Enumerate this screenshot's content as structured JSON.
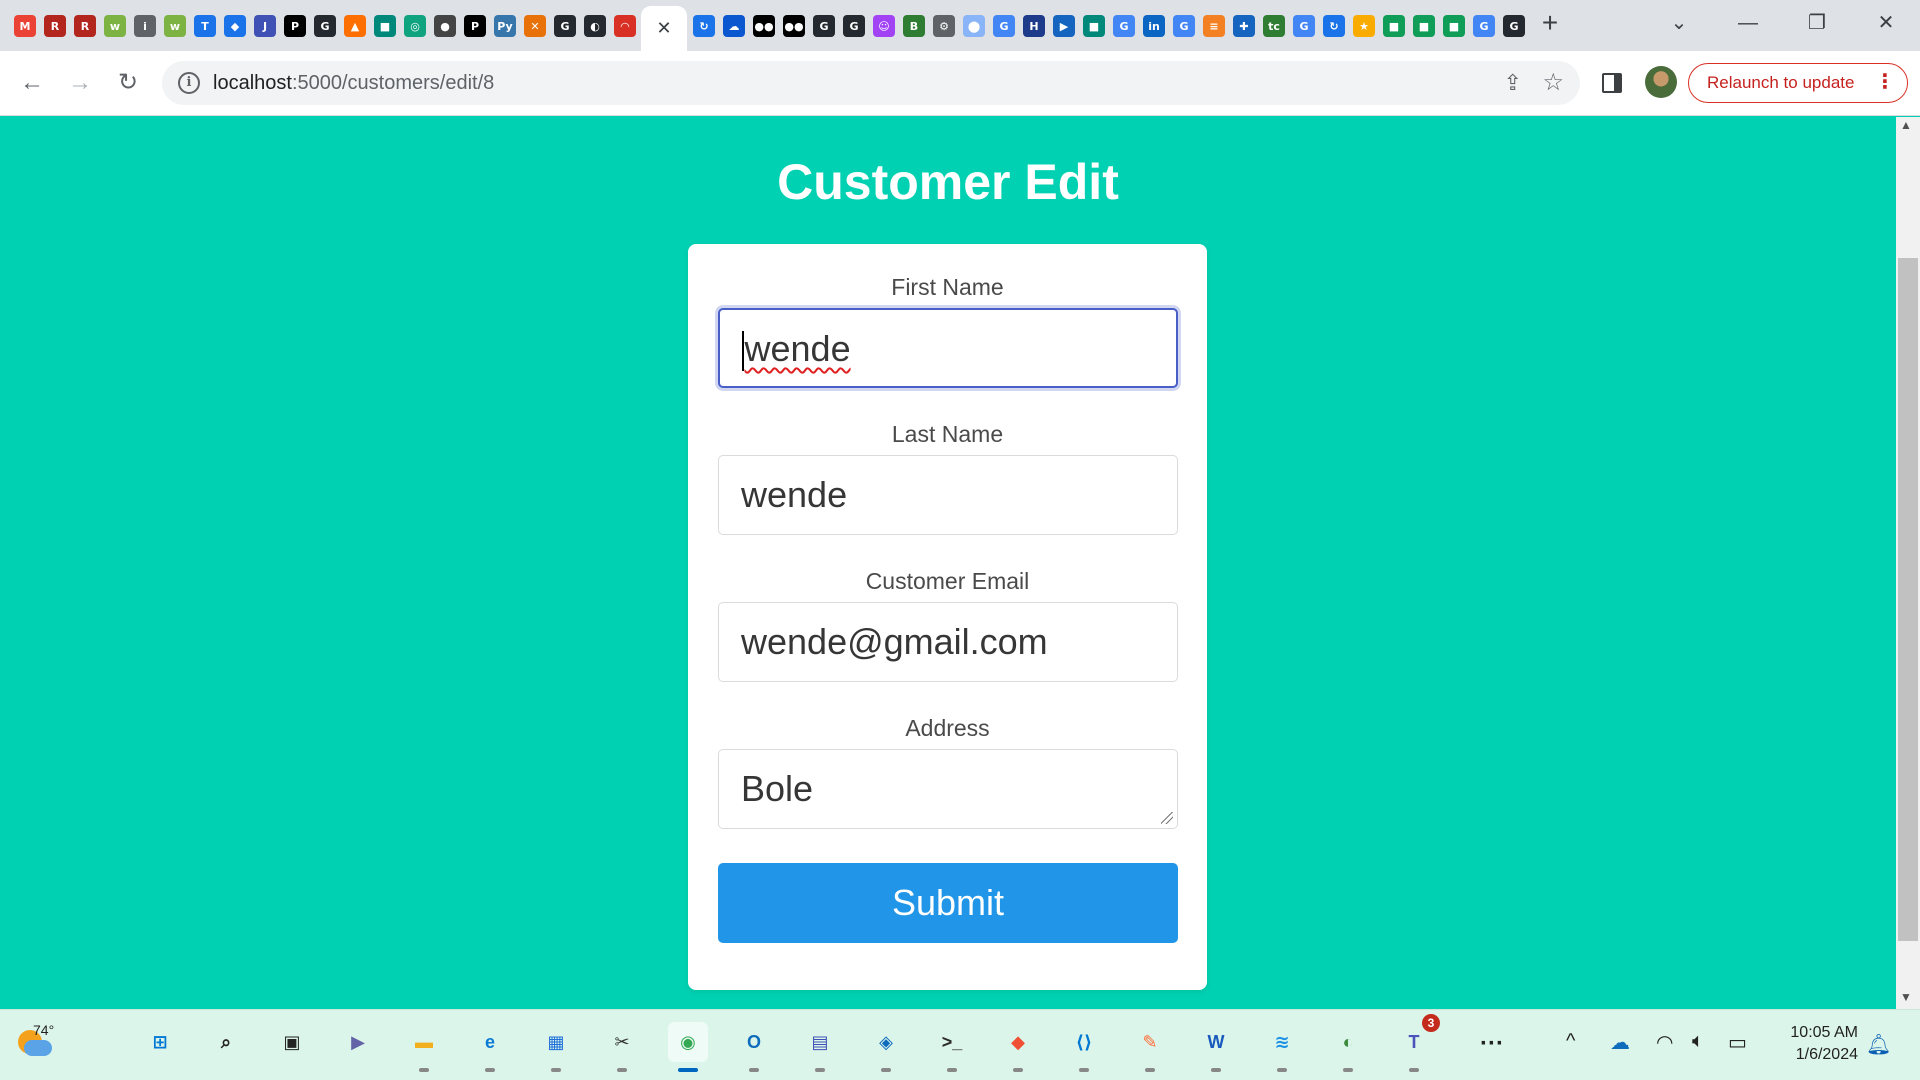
{
  "browser": {
    "tabs_left": [
      {
        "icon": "gmail-icon",
        "glyph": "M",
        "color": "#ea4335"
      },
      {
        "icon": "tab-icon-red-1",
        "glyph": "R",
        "color": "#b3261e"
      },
      {
        "icon": "tab-icon-red-2",
        "glyph": "R",
        "color": "#b3261e"
      },
      {
        "icon": "tab-icon-green-1",
        "glyph": "w",
        "color": "#7cb342"
      },
      {
        "icon": "info-tab-icon",
        "glyph": "i",
        "color": "#5f6368"
      },
      {
        "icon": "tab-icon-green-2",
        "glyph": "w",
        "color": "#7cb342"
      },
      {
        "icon": "tab-icon-t",
        "glyph": "T",
        "color": "#1a73e8"
      },
      {
        "icon": "tab-icon-diamond",
        "glyph": "◆",
        "color": "#1a73e8"
      },
      {
        "icon": "tab-icon-j2c",
        "glyph": "J",
        "color": "#3f51b5"
      },
      {
        "icon": "tab-icon-p",
        "glyph": "P",
        "color": "#000000"
      },
      {
        "icon": "github-icon",
        "glyph": "G",
        "color": "#24292f"
      },
      {
        "icon": "tab-icon-orange",
        "glyph": "▲",
        "color": "#ff6f00"
      },
      {
        "icon": "meet-icon",
        "glyph": "■",
        "color": "#00897b"
      },
      {
        "icon": "chatgpt-icon",
        "glyph": "◎",
        "color": "#10a37f"
      },
      {
        "icon": "tab-icon-globe",
        "glyph": "●",
        "color": "#444444"
      },
      {
        "icon": "tab-icon-p2",
        "glyph": "P",
        "color": "#000000"
      },
      {
        "icon": "python-icon",
        "glyph": "Py",
        "color": "#3776ab"
      },
      {
        "icon": "tab-icon-x",
        "glyph": "✕",
        "color": "#e8710a"
      },
      {
        "icon": "github-icon-2",
        "glyph": "G",
        "color": "#24292f"
      },
      {
        "icon": "tab-icon-circle",
        "glyph": "◐",
        "color": "#24292f"
      },
      {
        "icon": "tab-icon-arc",
        "glyph": "◠",
        "color": "#d93025"
      }
    ],
    "active_tab_close": "✕",
    "tabs_right": [
      {
        "icon": "tab-icon-loop",
        "glyph": "↻",
        "color": "#1a73e8"
      },
      {
        "icon": "tab-icon-cloud",
        "glyph": "☁",
        "color": "#0b57d0"
      },
      {
        "icon": "medium-icon-1",
        "glyph": "●●",
        "color": "#000000"
      },
      {
        "icon": "medium-icon-2",
        "glyph": "●●",
        "color": "#000000"
      },
      {
        "icon": "github-icon-3",
        "glyph": "G",
        "color": "#24292f"
      },
      {
        "icon": "github-icon-4",
        "glyph": "G",
        "color": "#24292f"
      },
      {
        "icon": "tab-icon-bot",
        "glyph": "☺",
        "color": "#a142f4"
      },
      {
        "icon": "tab-icon-b64",
        "glyph": "B",
        "color": "#2e7d32"
      },
      {
        "icon": "tab-icon-gear",
        "glyph": "⚙",
        "color": "#5f6368"
      },
      {
        "icon": "tab-icon-pin",
        "glyph": "⬤",
        "color": "#8ab4f8"
      },
      {
        "icon": "google-icon-1",
        "glyph": "G",
        "color": "#4285f4"
      },
      {
        "icon": "tab-icon-hst",
        "glyph": "H",
        "color": "#1e3a8a"
      },
      {
        "icon": "tab-icon-video",
        "glyph": "▶",
        "color": "#1565c0"
      },
      {
        "icon": "meet-icon-2",
        "glyph": "■",
        "color": "#00897b"
      },
      {
        "icon": "google-icon-2",
        "glyph": "G",
        "color": "#4285f4"
      },
      {
        "icon": "linkedin-icon",
        "glyph": "in",
        "color": "#0a66c2"
      },
      {
        "icon": "google-icon-3",
        "glyph": "G",
        "color": "#4285f4"
      },
      {
        "icon": "stackoverflow-icon",
        "glyph": "≡",
        "color": "#f48024"
      },
      {
        "icon": "tab-icon-puzzle",
        "glyph": "✚",
        "color": "#1565c0"
      },
      {
        "icon": "tab-icon-tc",
        "glyph": "tc",
        "color": "#2e7d32"
      },
      {
        "icon": "google-icon-4",
        "glyph": "G",
        "color": "#4285f4"
      },
      {
        "icon": "tab-icon-loop-2",
        "glyph": "↻",
        "color": "#1a73e8"
      },
      {
        "icon": "tab-icon-star",
        "glyph": "★",
        "color": "#f9ab00"
      },
      {
        "icon": "sheets-icon-1",
        "glyph": "■",
        "color": "#0f9d58"
      },
      {
        "icon": "sheets-icon-2",
        "glyph": "■",
        "color": "#0f9d58"
      },
      {
        "icon": "sheets-icon-3",
        "glyph": "■",
        "color": "#0f9d58"
      },
      {
        "icon": "google-icon-5",
        "glyph": "G",
        "color": "#4285f4"
      },
      {
        "icon": "github-icon-5",
        "glyph": "G",
        "color": "#24292f"
      }
    ],
    "new_tab": "+",
    "url_host": "localhost",
    "url_path": ":5000/customers/edit/8",
    "relaunch_label": "Relaunch to update"
  },
  "page": {
    "title": "Customer Edit",
    "fields": {
      "first_name": {
        "label": "First Name",
        "value": "wende"
      },
      "last_name": {
        "label": "Last Name",
        "value": "wende"
      },
      "email": {
        "label": "Customer Email",
        "value": "wende@gmail.com"
      },
      "address": {
        "label": "Address",
        "value": "Bole"
      }
    },
    "submit_label": "Submit"
  },
  "taskbar": {
    "weather_temp": "74°",
    "apps": [
      {
        "name": "windows-start-icon",
        "glyph": "⊞",
        "color": "#0078d4"
      },
      {
        "name": "search-icon",
        "glyph": "⌕",
        "color": "#222222"
      },
      {
        "name": "task-view-icon",
        "glyph": "▣",
        "color": "#222222"
      },
      {
        "name": "teams-chat-icon",
        "glyph": "▶",
        "color": "#6264a7"
      },
      {
        "name": "file-explorer-icon",
        "glyph": "▬",
        "color": "#f2b01e"
      },
      {
        "name": "edge-icon",
        "glyph": "e",
        "color": "#0c7bd6"
      },
      {
        "name": "store-icon",
        "glyph": "▦",
        "color": "#1e6fd9"
      },
      {
        "name": "snipping-icon",
        "glyph": "✂",
        "color": "#333333"
      },
      {
        "name": "chrome-icon",
        "glyph": "◉",
        "color": "#34a853"
      },
      {
        "name": "outlook-icon",
        "glyph": "O",
        "color": "#0f6cbd"
      },
      {
        "name": "network-icon",
        "glyph": "▤",
        "color": "#3f51b5"
      },
      {
        "name": "defender-icon",
        "glyph": "◈",
        "color": "#0f6cbd"
      },
      {
        "name": "terminal-icon",
        "glyph": ">_",
        "color": "#2b2b2b"
      },
      {
        "name": "git-icon",
        "glyph": "◆",
        "color": "#f05033"
      },
      {
        "name": "vscode-icon",
        "glyph": "⟨⟩",
        "color": "#0078d4"
      },
      {
        "name": "postman-icon",
        "glyph": "✎",
        "color": "#ff6c37"
      },
      {
        "name": "word-icon",
        "glyph": "W",
        "color": "#185abd"
      },
      {
        "name": "docker-icon",
        "glyph": "≋",
        "color": "#1d91e6"
      },
      {
        "name": "mongodb-compass-icon",
        "glyph": "◐",
        "color": "#3b8a3e"
      },
      {
        "name": "teams-icon",
        "glyph": "T",
        "color": "#4b53bc"
      }
    ],
    "teams_badge": "3",
    "more_glyph": "···",
    "tray_chevron": "^",
    "time": "10:05 AM",
    "date": "1/6/2024"
  }
}
